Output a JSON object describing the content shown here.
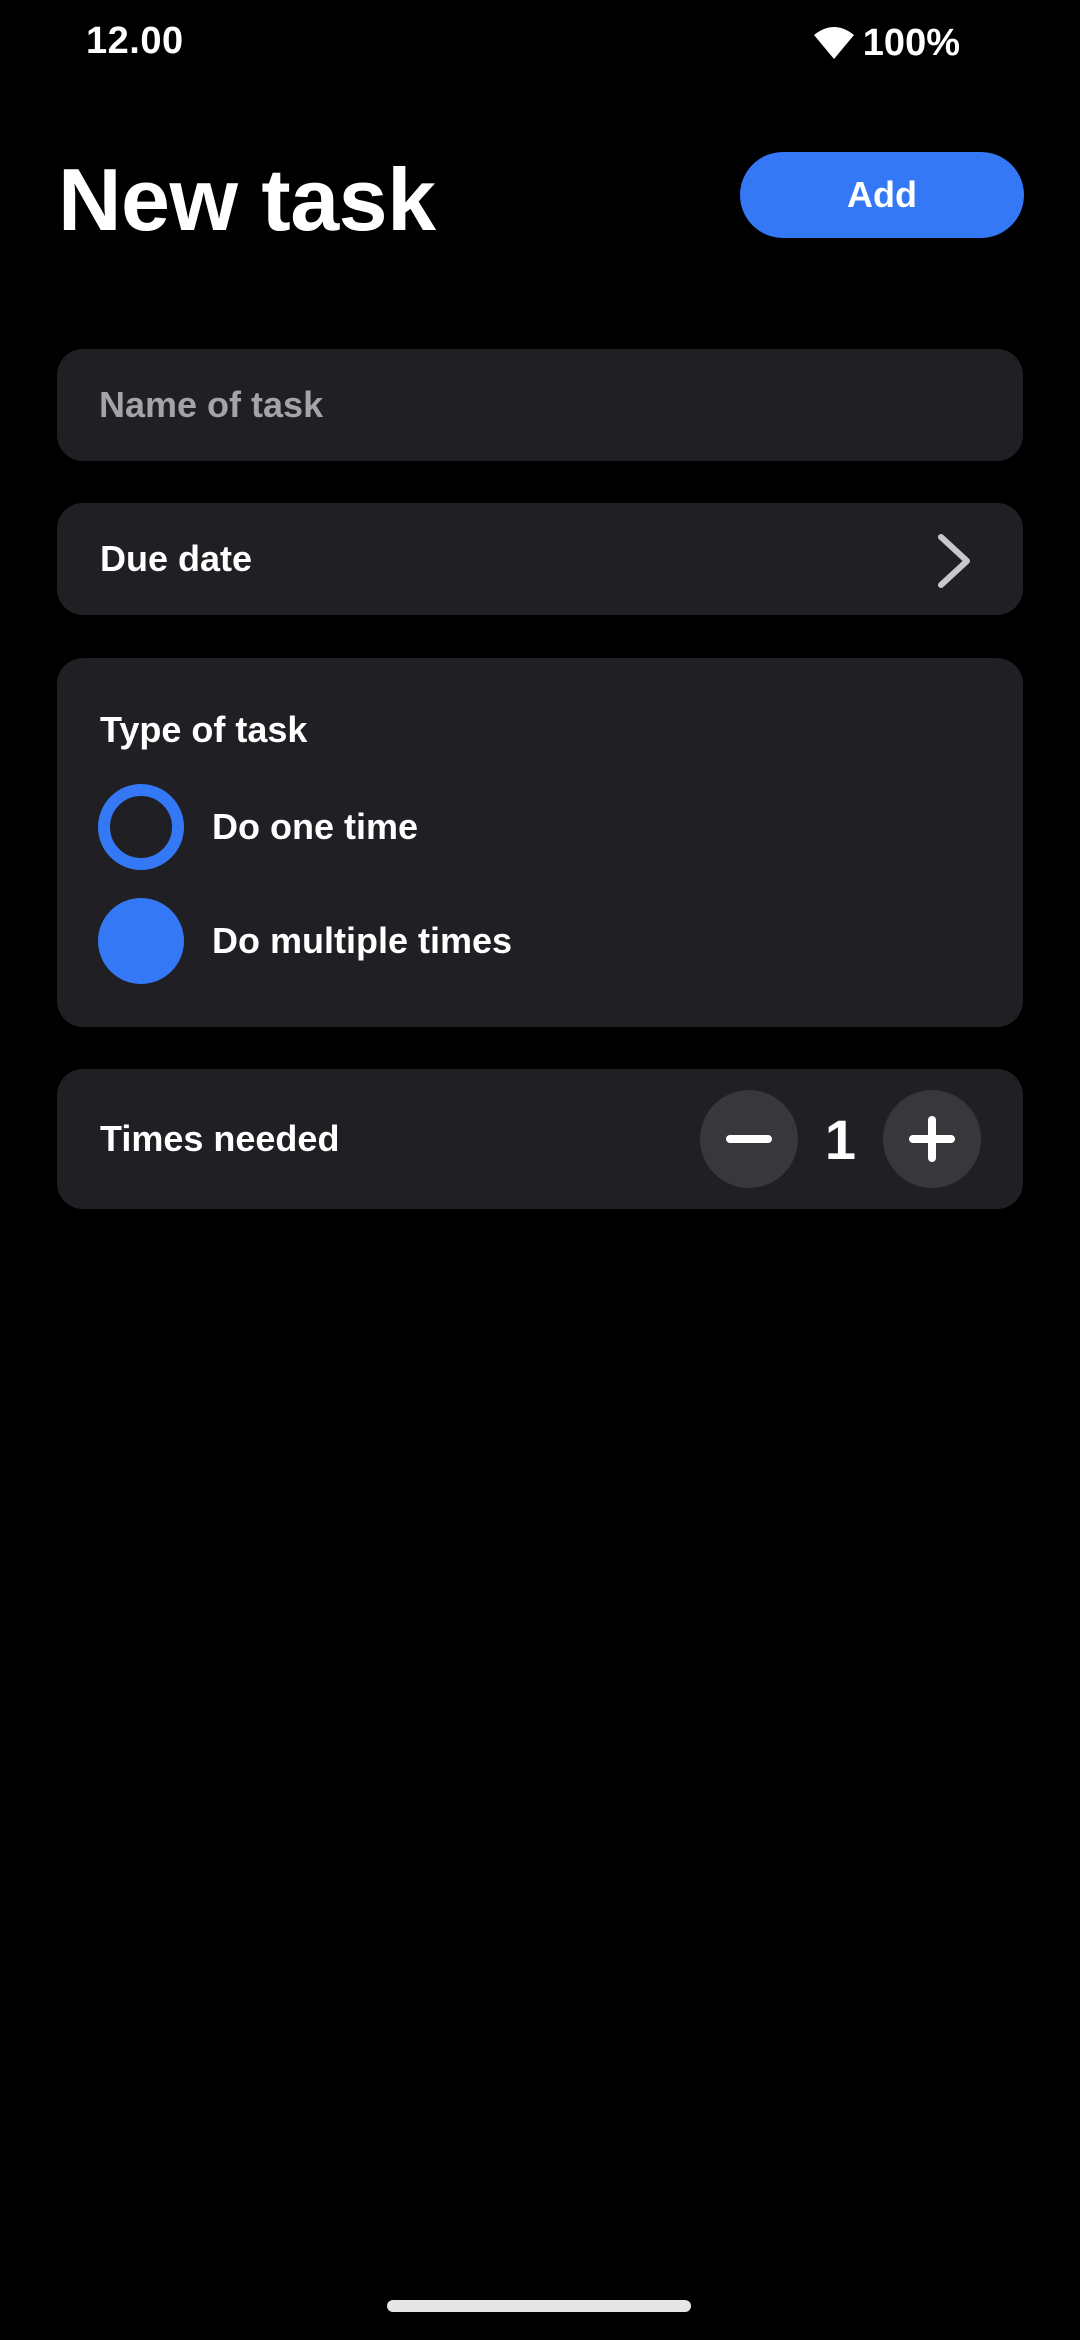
{
  "status_bar": {
    "time": "12.00",
    "battery": "100%",
    "wifi_icon": "wifi-icon"
  },
  "header": {
    "title": "New task",
    "add_label": "Add"
  },
  "form": {
    "name_placeholder": "Name of task",
    "name_value": "",
    "due_date_label": "Due date",
    "due_date_icon": "chevron-right-icon",
    "type_of_task": {
      "title": "Type of task",
      "options": [
        {
          "label": "Do one time",
          "selected": false
        },
        {
          "label": "Do multiple times",
          "selected": true
        }
      ]
    },
    "times_needed": {
      "label": "Times needed",
      "value": "1",
      "decrement_icon": "minus-icon",
      "increment_icon": "plus-icon"
    }
  },
  "colors": {
    "background": "#000000",
    "card": "#1f1f24",
    "accent": "#3478f6",
    "stepper_button": "#37373c",
    "placeholder": "#a3a3aa"
  }
}
